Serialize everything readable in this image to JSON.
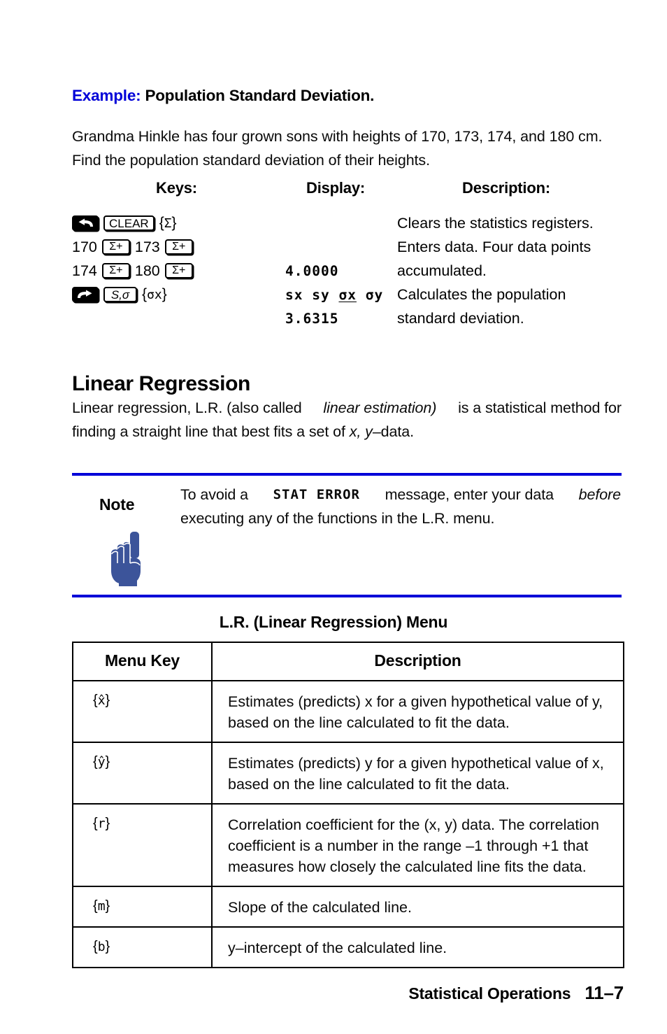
{
  "example": {
    "label": "Example:",
    "title": "Population Standard Deviation.",
    "intro_line1": "Grandma Hinkle has four grown sons with heights of 170, 173, 174, and 180 cm.",
    "intro_line2": "Find the population standard deviation of their heights."
  },
  "keys_table": {
    "headers": {
      "keys": "Keys:",
      "display": "Display:",
      "description": "Description:"
    },
    "rows": [
      {
        "keys_text": "{Σ}",
        "keycaps": [
          "left-shift-arrow",
          "CLEAR"
        ],
        "display": "",
        "description": "Clears the statistics registers."
      },
      {
        "keys_text": "",
        "prefix1": "170",
        "prefix2": "173",
        "keycap_label": "Σ+",
        "display": "",
        "description": "Enters data. Four data points"
      },
      {
        "keys_text": "",
        "prefix1": "174",
        "prefix2": "180",
        "keycap_label": "Σ+",
        "display": "4.0000",
        "description": "accumulated."
      },
      {
        "keys_text": "{σx}",
        "keycaps": [
          "right-shift-arrow",
          "S,σ"
        ],
        "display": "sx sy σx σy",
        "display_parts": [
          "sx",
          "sy",
          "σx",
          "σy"
        ],
        "display_underlined_index": 2,
        "description": "Calculates the population"
      },
      {
        "keys_text": "",
        "display": "3.6315",
        "description": "standard deviation."
      }
    ],
    "keycap_labels": {
      "clear": "CLEAR",
      "sigma_plus": "Σ+",
      "s_sigma": "S,σ"
    }
  },
  "linear_regression": {
    "heading": "Linear Regression",
    "para_line1": "Linear regression, L.R. (also called",
    "para_italic": "linear estimation)",
    "para_line1b": "is a statistical method for",
    "para_line2a": "finding a straight line that best fits a set of",
    "para_line2_italic": "x, y",
    "para_line2b": "–data."
  },
  "note": {
    "label": "Note",
    "icon": "pointing-hand-icon",
    "text_part1": "To avoid a",
    "text_lcd": "STAT ERROR",
    "text_part2": "message, enter your data",
    "text_italic": "before",
    "text_line2": "executing any of the functions in the L.R. menu.",
    "rule_color": "#0000d8"
  },
  "lr_menu_table": {
    "caption": "L.R. (Linear Regression) Menu",
    "columns": [
      "Menu Key",
      "Description"
    ],
    "rows": [
      {
        "key": "{x̂}",
        "desc_line1": "Estimates (predicts) x for a given hypothetical value of y,",
        "desc_line2": "based on the line calculated to fit the data."
      },
      {
        "key": "{ŷ}",
        "desc_line1": "Estimates (predicts) y for a given hypothetical value of x,",
        "desc_line2": "based on the line calculated to fit the data."
      },
      {
        "key": "{r}",
        "desc_line1": "Correlation coefficient for the (x, y) data. The correlation",
        "desc_line2": "coefficient is a number in the range –1 through +1 that",
        "desc_line3": "measures how closely the calculated line fits the data."
      },
      {
        "key": "{m}",
        "desc_line1": "Slope of the calculated line."
      },
      {
        "key": "{b}",
        "desc_line1": "y–intercept of the calculated line."
      }
    ]
  },
  "footer": {
    "chapter_title": "Statistical Operations",
    "page_number": "11–7"
  },
  "colors": {
    "accent_blue": "#0000d8",
    "hand_blue": "#3c549a",
    "text_black": "#0a0a0a"
  }
}
